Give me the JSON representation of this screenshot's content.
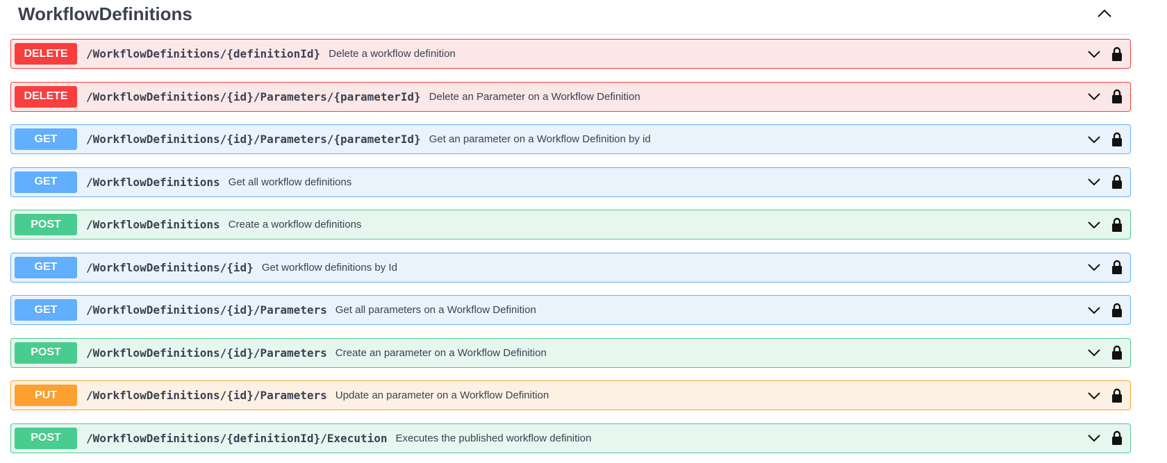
{
  "section": {
    "title": "WorkflowDefinitions",
    "collapse_icon": "chevron-up-icon"
  },
  "colors": {
    "delete": "#f93e3e",
    "get": "#61affe",
    "post": "#49cc90",
    "put": "#fca130"
  },
  "operations": [
    {
      "method": "DELETE",
      "path": "/WorkflowDefinitions/{definitionId}",
      "summary": "Delete a workflow definition"
    },
    {
      "method": "DELETE",
      "path": "/WorkflowDefinitions/{id}/Parameters/{parameterId}",
      "summary": "Delete an Parameter on a Workflow Definition"
    },
    {
      "method": "GET",
      "path": "/WorkflowDefinitions/{id}/Parameters/{parameterId}",
      "summary": "Get an parameter on a Workflow Definition by id"
    },
    {
      "method": "GET",
      "path": "/WorkflowDefinitions",
      "summary": "Get all workflow definitions"
    },
    {
      "method": "POST",
      "path": "/WorkflowDefinitions",
      "summary": "Create a workflow definitions"
    },
    {
      "method": "GET",
      "path": "/WorkflowDefinitions/{id}",
      "summary": "Get workflow definitions by Id"
    },
    {
      "method": "GET",
      "path": "/WorkflowDefinitions/{id}/Parameters",
      "summary": "Get all parameters on a Workflow Definition"
    },
    {
      "method": "POST",
      "path": "/WorkflowDefinitions/{id}/Parameters",
      "summary": "Create an parameter on a Workflow Definition"
    },
    {
      "method": "PUT",
      "path": "/WorkflowDefinitions/{id}/Parameters",
      "summary": "Update an parameter on a Workflow Definition"
    },
    {
      "method": "POST",
      "path": "/WorkflowDefinitions/{definitionId}/Execution",
      "summary": "Executes the published workflow definition"
    }
  ],
  "icons": {
    "expand": "chevron-down-icon",
    "auth": "lock-icon"
  }
}
